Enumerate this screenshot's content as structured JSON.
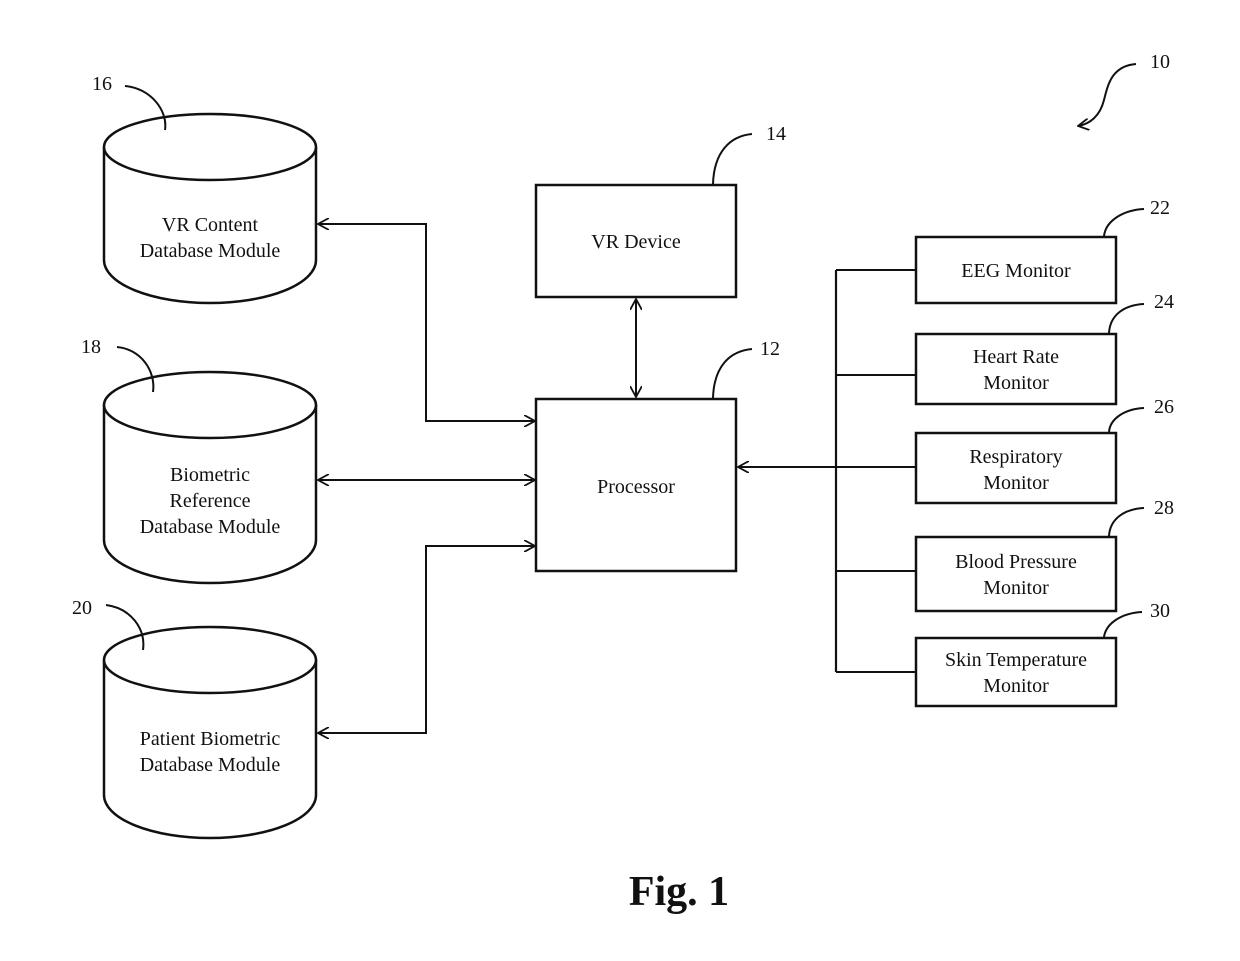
{
  "figure": {
    "caption": "Fig. 1",
    "system_ref": "10"
  },
  "nodes": {
    "processor": {
      "ref": "12",
      "label": "Processor"
    },
    "vr_device": {
      "ref": "14",
      "label": "VR Device"
    },
    "vr_content_db": {
      "ref": "16",
      "label_lines": [
        "VR Content",
        "Database Module"
      ]
    },
    "biometric_reference_db": {
      "ref": "18",
      "label_lines": [
        "Biometric",
        "Reference",
        "Database Module"
      ]
    },
    "patient_biometric_db": {
      "ref": "20",
      "label_lines": [
        "Patient Biometric",
        "Database Module"
      ]
    },
    "monitors": [
      {
        "ref": "22",
        "label_lines": [
          "EEG Monitor"
        ]
      },
      {
        "ref": "24",
        "label_lines": [
          "Heart Rate",
          "Monitor"
        ]
      },
      {
        "ref": "26",
        "label_lines": [
          "Respiratory",
          "Monitor"
        ]
      },
      {
        "ref": "28",
        "label_lines": [
          "Blood Pressure",
          "Monitor"
        ]
      },
      {
        "ref": "30",
        "label_lines": [
          "Skin Temperature",
          "Monitor"
        ]
      }
    ]
  },
  "connections": [
    {
      "from": "processor",
      "to": "vr_content_db",
      "direction": "bidirectional"
    },
    {
      "from": "processor",
      "to": "biometric_reference_db",
      "direction": "bidirectional"
    },
    {
      "from": "processor",
      "to": "patient_biometric_db",
      "direction": "bidirectional"
    },
    {
      "from": "processor",
      "to": "vr_device",
      "direction": "bidirectional"
    },
    {
      "from": "monitors_bus",
      "to": "processor",
      "direction": "one-way"
    }
  ]
}
